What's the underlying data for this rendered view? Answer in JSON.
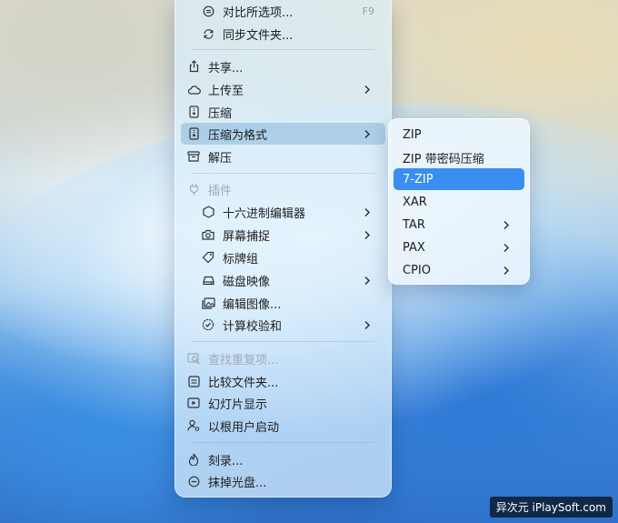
{
  "menu": {
    "items": [
      {
        "label": "对比所选项...",
        "shortcut": "F9",
        "icon": "compare-icon"
      },
      {
        "label": "同步文件夹...",
        "icon": "sync-icon"
      },
      {
        "label": "共享...",
        "icon": "share-icon"
      },
      {
        "label": "上传至",
        "icon": "cloud-icon",
        "chevron": ">"
      },
      {
        "label": "压缩",
        "icon": "zip-icon"
      },
      {
        "label": "压缩为格式",
        "icon": "zip-icon",
        "chevron": ">"
      },
      {
        "label": "解压",
        "icon": "extract-icon"
      },
      {
        "label": "插件",
        "icon": "plugin-icon"
      },
      {
        "label": "十六进制编辑器",
        "icon": "hexagon-icon",
        "chevron": ">"
      },
      {
        "label": "屏幕捕捉",
        "icon": "camera-icon",
        "chevron": ">"
      },
      {
        "label": "标牌组",
        "icon": "tag-icon"
      },
      {
        "label": "磁盘映像",
        "icon": "disk-icon",
        "chevron": ">"
      },
      {
        "label": "编辑图像...",
        "icon": "image-icon"
      },
      {
        "label": "计算校验和",
        "icon": "checksum-icon",
        "chevron": ">"
      },
      {
        "label": "查找重复项...",
        "icon": "find-duplicates-icon"
      },
      {
        "label": "比较文件夹...",
        "icon": "compare-folder-icon"
      },
      {
        "label": "幻灯片显示",
        "icon": "slideshow-icon"
      },
      {
        "label": "以根用户启动",
        "icon": "root-user-icon"
      },
      {
        "label": "刻录...",
        "icon": "burn-icon"
      },
      {
        "label": "抹掉光盘...",
        "icon": "erase-icon"
      }
    ]
  },
  "submenu": {
    "items": [
      {
        "label": "ZIP"
      },
      {
        "label": "ZIP 带密码压缩"
      },
      {
        "label": "7-ZIP"
      },
      {
        "label": "XAR"
      },
      {
        "label": "TAR",
        "chevron": ">"
      },
      {
        "label": "PAX",
        "chevron": ">"
      },
      {
        "label": "CPIO",
        "chevron": ">"
      }
    ]
  },
  "watermark": "异次元 iPlaySoft.com"
}
